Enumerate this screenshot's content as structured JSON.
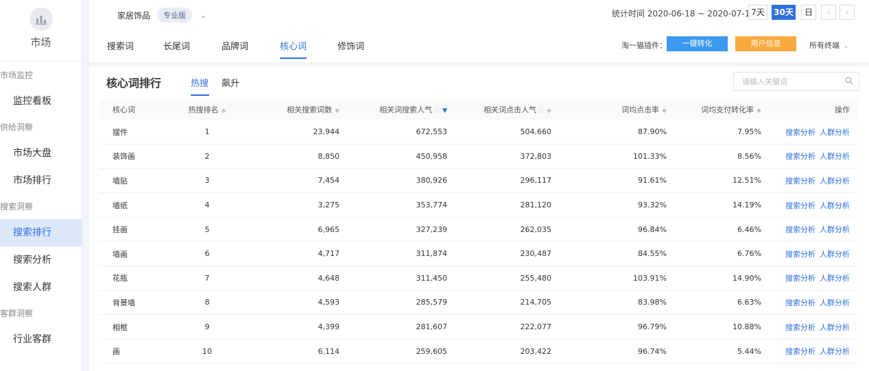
{
  "sidebar": {
    "title": "市场",
    "groups": [
      {
        "label": "市场监控",
        "items": [
          {
            "label": "监控看板"
          }
        ]
      },
      {
        "label": "供给洞察",
        "items": [
          {
            "label": "市场大盘"
          },
          {
            "label": "市场排行"
          }
        ]
      },
      {
        "label": "搜索洞察",
        "items": [
          {
            "label": "搜索排行",
            "active": true
          },
          {
            "label": "搜索分析"
          },
          {
            "label": "搜索人群"
          }
        ]
      },
      {
        "label": "客群洞察",
        "items": [
          {
            "label": "行业客群"
          }
        ]
      }
    ]
  },
  "header": {
    "category": "家居饰品",
    "badge": "专业版",
    "stat_time": "统计时间 2020-06-18 ~ 2020-07-17",
    "ranges": [
      "7天",
      "30天",
      "日"
    ],
    "active_range": "30天",
    "tabs": [
      "搜索词",
      "长尾词",
      "品牌词",
      "核心词",
      "修饰词"
    ],
    "active_tab": "核心词",
    "plugin_label": "淘一猫插件：",
    "convert_button": "一键转化",
    "user_info_button": "用户信息",
    "terminal": "所有终端"
  },
  "panel": {
    "title": "核心词排行",
    "sub_tabs": [
      "热搜",
      "飙升"
    ],
    "search_placeholder": "请输入关键词",
    "columns": [
      "核心词",
      "热搜排名",
      "相关搜索词数",
      "相关词搜索人气",
      "相关词点击人气",
      "词均点击率",
      "词均支付转化率",
      "操作"
    ],
    "rows": [
      [
        "摆件",
        "1",
        "23,944",
        "672,553",
        "504,660",
        "87.90%",
        "7.95%"
      ],
      [
        "装饰画",
        "2",
        "8,850",
        "450,958",
        "372,803",
        "101.33%",
        "8.56%"
      ],
      [
        "墙贴",
        "3",
        "7,454",
        "380,926",
        "296,117",
        "91.61%",
        "12.51%"
      ],
      [
        "墙纸",
        "4",
        "3,275",
        "353,774",
        "281,120",
        "93.32%",
        "14.19%"
      ],
      [
        "挂画",
        "5",
        "6,965",
        "327,239",
        "262,035",
        "96.84%",
        "6.46%"
      ],
      [
        "墙画",
        "6",
        "4,717",
        "311,874",
        "230,487",
        "84.55%",
        "6.76%"
      ],
      [
        "花瓶",
        "7",
        "4,648",
        "311,450",
        "255,480",
        "103.91%",
        "14.90%"
      ],
      [
        "背景墙",
        "8",
        "4,593",
        "285,579",
        "214,705",
        "83.98%",
        "6.63%"
      ],
      [
        "相框",
        "9",
        "4,399",
        "281,607",
        "222,077",
        "96.79%",
        "10.88%"
      ],
      [
        "画",
        "10",
        "6,114",
        "259,605",
        "203,422",
        "96.74%",
        "5.44%"
      ]
    ],
    "action_search": "搜索分析",
    "action_crowd": "人群分析"
  }
}
